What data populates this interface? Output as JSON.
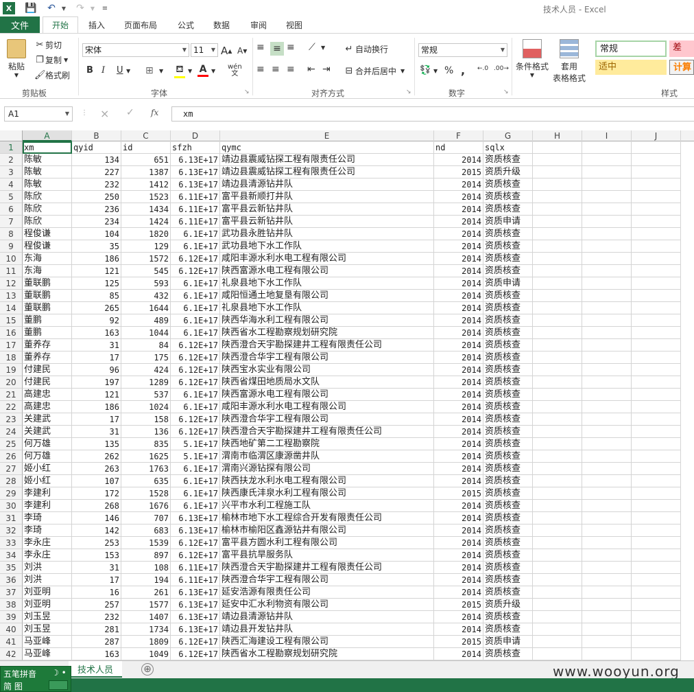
{
  "title": "技术人员 - Excel",
  "file_tab": "文件",
  "tabs": [
    "开始",
    "插入",
    "页面布局",
    "公式",
    "数据",
    "审阅",
    "视图"
  ],
  "ribbon": {
    "clipboard": {
      "paste": "粘贴",
      "cut": "剪切",
      "copy": "复制",
      "format_painter": "格式刷",
      "label": "剪贴板"
    },
    "font": {
      "name": "宋体",
      "size": "11",
      "label": "字体",
      "bold": "B",
      "italic": "I",
      "underline": "U"
    },
    "alignment": {
      "wrap": "自动换行",
      "merge": "合并后居中",
      "label": "对齐方式"
    },
    "number": {
      "format": "常规",
      "label": "数字"
    },
    "styles": {
      "cond_format": "条件格式",
      "table_format_1": "套用",
      "table_format_2": "表格格式",
      "normal": "常规",
      "bad": "差",
      "neutral": "适中",
      "calc": "计算",
      "label": "样式"
    }
  },
  "formula_bar": {
    "cell": "A1",
    "content": "xm"
  },
  "columns": [
    "A",
    "B",
    "C",
    "D",
    "E",
    "F",
    "G",
    "H",
    "I",
    "J"
  ],
  "header_row": [
    "xm",
    "qyid",
    "id",
    "sfzh",
    "qymc",
    "nd",
    "sqlx"
  ],
  "rows": [
    [
      "陈敏",
      "134",
      "651",
      "6.13E+17",
      "靖边县震威钻探工程有限责任公司",
      "2014",
      "资质核查"
    ],
    [
      "陈敏",
      "227",
      "1387",
      "6.13E+17",
      "靖边县震威钻探工程有限责任公司",
      "2015",
      "资质升级"
    ],
    [
      "陈敏",
      "232",
      "1412",
      "6.13E+17",
      "靖边县清源钻井队",
      "2014",
      "资质核查"
    ],
    [
      "陈欣",
      "250",
      "1523",
      "6.11E+17",
      "富平县新顺打井队",
      "2014",
      "资质核查"
    ],
    [
      "陈欣",
      "236",
      "1434",
      "6.11E+17",
      "富平县云新钻井队",
      "2014",
      "资质核查"
    ],
    [
      "陈欣",
      "234",
      "1424",
      "6.11E+17",
      "富平县云新钻井队",
      "2014",
      "资质申请"
    ],
    [
      "程俊谦",
      "104",
      "1820",
      "6.1E+17",
      "武功县永胜钻井队",
      "2014",
      "资质核查"
    ],
    [
      "程俊谦",
      "35",
      "129",
      "6.1E+17",
      "武功县地下水工作队",
      "2014",
      "资质核查"
    ],
    [
      "东海",
      "186",
      "1572",
      "6.12E+17",
      "咸阳丰源水利水电工程有限公司",
      "2014",
      "资质核查"
    ],
    [
      "东海",
      "121",
      "545",
      "6.12E+17",
      "陕西富源水电工程有限公司",
      "2014",
      "资质核查"
    ],
    [
      "董联鹏",
      "125",
      "593",
      "6.1E+17",
      "礼泉县地下水工作队",
      "2014",
      "资质申请"
    ],
    [
      "董联鹏",
      "85",
      "432",
      "6.1E+17",
      "咸阳恒通土地复垦有限公司",
      "2014",
      "资质核查"
    ],
    [
      "董联鹏",
      "265",
      "1644",
      "6.1E+17",
      "礼泉县地下水工作队",
      "2014",
      "资质核查"
    ],
    [
      "董鹏",
      "92",
      "489",
      "6.1E+17",
      "陕西华海水利工程有限公司",
      "2014",
      "资质核查"
    ],
    [
      "董鹏",
      "163",
      "1044",
      "6.1E+17",
      "陕西省水工程勘察规划研究院",
      "2014",
      "资质核查"
    ],
    [
      "董养存",
      "31",
      "84",
      "6.12E+17",
      "陕西澄合天宇勘探建井工程有限责任公司",
      "2014",
      "资质核查"
    ],
    [
      "董养存",
      "17",
      "175",
      "6.12E+17",
      "陕西澄合华宇工程有限公司",
      "2014",
      "资质核查"
    ],
    [
      "付建民",
      "96",
      "424",
      "6.12E+17",
      "陕西宝水实业有限公司",
      "2014",
      "资质核查"
    ],
    [
      "付建民",
      "197",
      "1289",
      "6.12E+17",
      "陕西省煤田地质局水文队",
      "2014",
      "资质核查"
    ],
    [
      "高建忠",
      "121",
      "537",
      "6.1E+17",
      "陕西富源水电工程有限公司",
      "2014",
      "资质核查"
    ],
    [
      "高建忠",
      "186",
      "1024",
      "6.1E+17",
      "咸阳丰源水利水电工程有限公司",
      "2014",
      "资质核查"
    ],
    [
      "关建武",
      "17",
      "158",
      "6.12E+17",
      "陕西澄合华宇工程有限公司",
      "2014",
      "资质核查"
    ],
    [
      "关建武",
      "31",
      "136",
      "6.12E+17",
      "陕西澄合天宇勘探建井工程有限责任公司",
      "2014",
      "资质核查"
    ],
    [
      "何万雄",
      "135",
      "835",
      "5.1E+17",
      "陕西地矿第二工程勘察院",
      "2014",
      "资质核查"
    ],
    [
      "何万雄",
      "262",
      "1625",
      "5.1E+17",
      "渭南市临渭区康源凿井队",
      "2014",
      "资质核查"
    ],
    [
      "姬小红",
      "263",
      "1763",
      "6.1E+17",
      "渭南兴源钻探有限公司",
      "2014",
      "资质核查"
    ],
    [
      "姬小红",
      "107",
      "635",
      "6.1E+17",
      "陕西扶龙水利水电工程有限公司",
      "2014",
      "资质核查"
    ],
    [
      "李建利",
      "172",
      "1528",
      "6.1E+17",
      "陕西康氏沣泉水利工程有限公司",
      "2015",
      "资质核查"
    ],
    [
      "李建利",
      "268",
      "1676",
      "6.1E+17",
      "兴平市水利工程施工队",
      "2014",
      "资质核查"
    ],
    [
      "李琦",
      "146",
      "707",
      "6.13E+17",
      "榆林市地下水工程综合开发有限责任公司",
      "2014",
      "资质核查"
    ],
    [
      "李琦",
      "142",
      "683",
      "6.13E+17",
      "榆林市榆阳区鑫源钻井有限公司",
      "2014",
      "资质核查"
    ],
    [
      "李永庄",
      "253",
      "1539",
      "6.12E+17",
      "富平县方圆水利工程有限公司",
      "2014",
      "资质核查"
    ],
    [
      "李永庄",
      "153",
      "897",
      "6.12E+17",
      "富平县抗旱服务队",
      "2014",
      "资质核查"
    ],
    [
      "刘洪",
      "31",
      "108",
      "6.11E+17",
      "陕西澄合天宇勘探建井工程有限责任公司",
      "2014",
      "资质核查"
    ],
    [
      "刘洪",
      "17",
      "194",
      "6.11E+17",
      "陕西澄合华宇工程有限公司",
      "2014",
      "资质核查"
    ],
    [
      "刘亚明",
      "16",
      "261",
      "6.13E+17",
      "延安浩源有限责任公司",
      "2014",
      "资质核查"
    ],
    [
      "刘亚明",
      "257",
      "1577",
      "6.13E+17",
      "延安中汇水利物资有限公司",
      "2015",
      "资质升级"
    ],
    [
      "刘玉昱",
      "232",
      "1407",
      "6.13E+17",
      "靖边县清源钻井队",
      "2014",
      "资质核查"
    ],
    [
      "刘玉昱",
      "281",
      "1734",
      "6.13E+17",
      "靖边县开发钻井队",
      "2014",
      "资质核查"
    ],
    [
      "马亚峰",
      "287",
      "1809",
      "6.12E+17",
      "陕西汇海建设工程有限公司",
      "2015",
      "资质申请"
    ],
    [
      "马亚峰",
      "163",
      "1049",
      "6.12E+17",
      "陕西省水工程勘察规划研究院",
      "2014",
      "资质核查"
    ]
  ],
  "sheet_tab": "技术人员",
  "watermark": "www.wooyun.org",
  "ime": {
    "line1": "五笔拼音",
    "line2": "简 图"
  },
  "icons": {
    "excel_logo": "excel-icon",
    "save": "save-icon",
    "undo": "undo-icon",
    "redo": "redo-icon",
    "cancel": "×",
    "confirm": "✓",
    "function": "fx",
    "add_sheet": "⊕"
  },
  "colors": {
    "accent": "#217346",
    "bad_bg": "#ffc7ce",
    "bad_fg": "#9c0006",
    "neutral_bg": "#ffeb9c",
    "neutral_fg": "#9c6500",
    "calc_fg": "#fa7d00"
  }
}
